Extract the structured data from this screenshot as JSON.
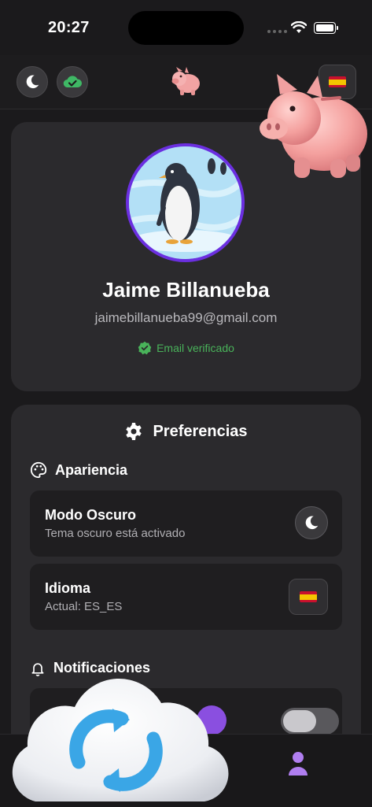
{
  "status_bar": {
    "time": "20:27"
  },
  "top_bar": {
    "theme_icon": "moon-icon",
    "sync_icon": "cloud-check-icon",
    "logo_icon": "piggy-bank-icon",
    "language_flag": "spain-flag-icon"
  },
  "profile": {
    "name": "Jaime Billanueba",
    "email": "jaimebillanueba99@gmail.com",
    "verified_label": "Email verificado",
    "avatar_icon": "penguin-avatar"
  },
  "preferences": {
    "title": "Preferencias",
    "appearance": {
      "heading": "Apariencia",
      "dark_mode": {
        "title": "Modo Oscuro",
        "subtitle": "Tema oscuro está activado"
      },
      "language": {
        "title": "Idioma",
        "subtitle": "Actual: ES_ES"
      }
    },
    "notifications": {
      "heading": "Notificaciones",
      "toggle_on": false
    }
  },
  "tab_bar": {
    "active_tab": "profile"
  },
  "overlays": [
    "piggy-bank-illustration",
    "cloud-sync-illustration"
  ],
  "colors": {
    "accent_purple": "#6b2fe0",
    "verified_green": "#49b35a",
    "background": "#1b1a1c",
    "card": "#2b2a2d"
  }
}
